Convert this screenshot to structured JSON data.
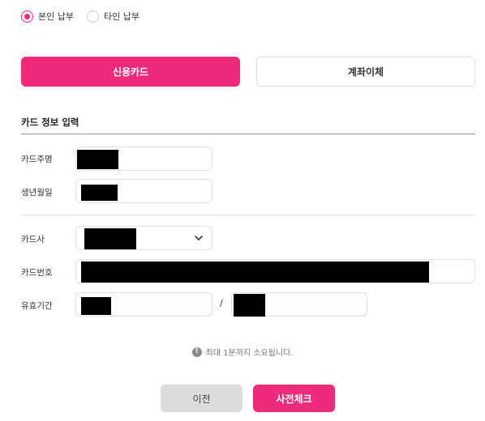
{
  "payer_type": {
    "options": [
      {
        "label": "본인 납부",
        "checked": true
      },
      {
        "label": "타인 납부",
        "checked": false
      }
    ]
  },
  "payment_tabs": {
    "card_label": "신용카드",
    "bank_label": "계좌이체",
    "active": "card"
  },
  "card_info": {
    "section_title": "카드 정보 입력",
    "owner_label": "카드주명",
    "birth_label": "생년월일",
    "company_label": "카드사",
    "number_label": "카드번호",
    "expiry_label": "유효기간",
    "expiry_separator": "/"
  },
  "notice": {
    "icon": "info-icon",
    "icon_glyph": "!",
    "text": "최대 1분까지 소요됩니다."
  },
  "buttons": {
    "prev_label": "이전",
    "check_label": "사전체크"
  },
  "colors": {
    "accent": "#ee2a7b",
    "secondary_button": "#dcdcdc"
  }
}
